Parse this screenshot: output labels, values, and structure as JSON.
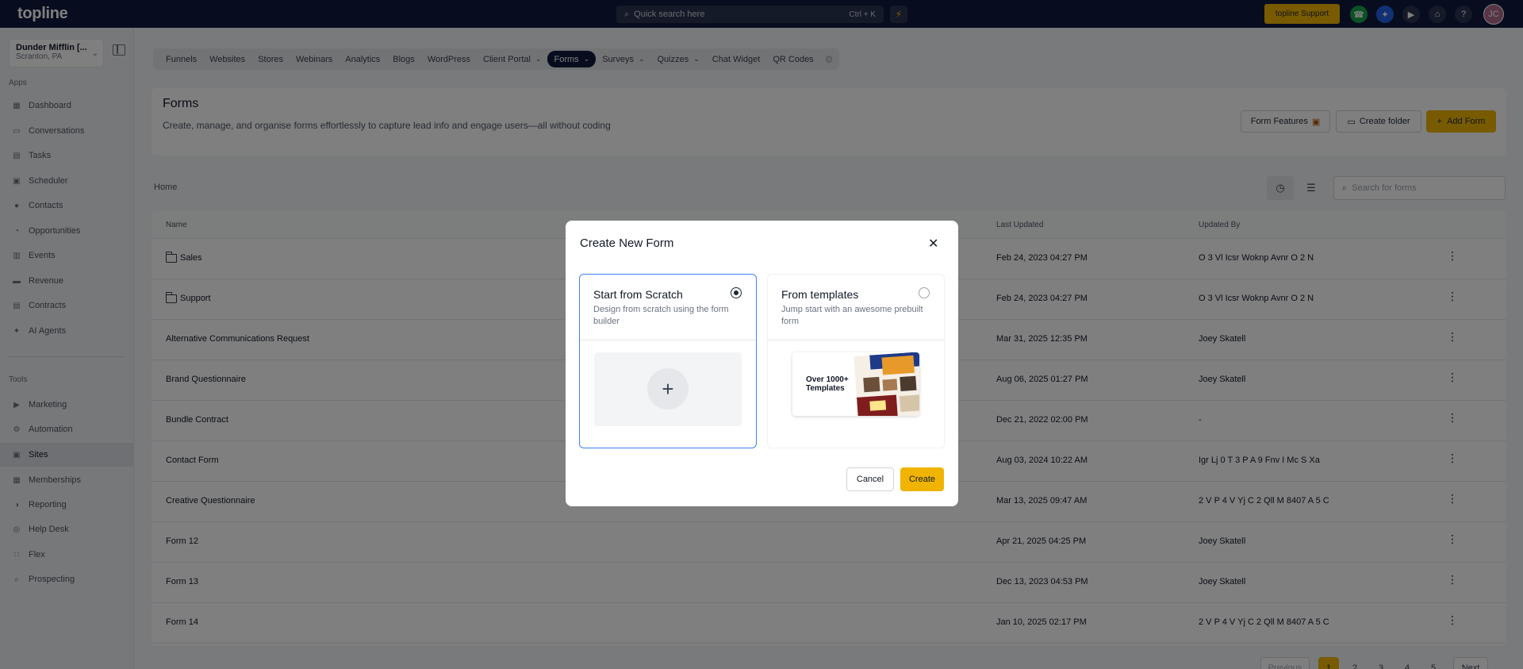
{
  "topbar": {
    "logo": "topline",
    "search_placeholder": "Quick search here",
    "search_shortcut": "Ctrl + K",
    "support_label": "topline Support",
    "avatar_initials": "JC"
  },
  "sidebar": {
    "account_name": "Dunder Mifflin [...",
    "account_location": "Scranton, PA",
    "apps_label": "Apps",
    "tools_label": "Tools",
    "apps": [
      {
        "label": "Dashboard",
        "icon": "dashboard-icon"
      },
      {
        "label": "Conversations",
        "icon": "chat-icon"
      },
      {
        "label": "Tasks",
        "icon": "tasks-icon"
      },
      {
        "label": "Scheduler",
        "icon": "calendar-icon"
      },
      {
        "label": "Contacts",
        "icon": "person-icon"
      },
      {
        "label": "Opportunities",
        "icon": "opportunities-icon"
      },
      {
        "label": "Events",
        "icon": "events-icon"
      },
      {
        "label": "Revenue",
        "icon": "revenue-icon"
      },
      {
        "label": "Contracts",
        "icon": "contracts-icon"
      },
      {
        "label": "AI Agents",
        "icon": "sparkle-icon"
      }
    ],
    "tools": [
      {
        "label": "Marketing",
        "icon": "megaphone-icon"
      },
      {
        "label": "Automation",
        "icon": "automation-icon"
      },
      {
        "label": "Sites",
        "icon": "sites-icon"
      },
      {
        "label": "Memberships",
        "icon": "memberships-icon"
      },
      {
        "label": "Reporting",
        "icon": "reporting-icon"
      },
      {
        "label": "Help Desk",
        "icon": "help-desk-icon"
      },
      {
        "label": "Flex",
        "icon": "flex-icon"
      },
      {
        "label": "Prospecting",
        "icon": "search-icon"
      }
    ]
  },
  "tabs": [
    "Funnels",
    "Websites",
    "Stores",
    "Webinars",
    "Analytics",
    "Blogs",
    "WordPress",
    "Client Portal",
    "Forms",
    "Surveys",
    "Quizzes",
    "Chat Widget",
    "QR Codes"
  ],
  "header": {
    "title": "Forms",
    "description": "Create, manage, and organise forms effortlessly to capture lead info and engage users—all without coding",
    "form_features_label": "Form Features",
    "create_folder_label": "Create folder",
    "add_form_label": "Add Form"
  },
  "breadcrumb": "Home",
  "forms_search_placeholder": "Search for forms",
  "table": {
    "columns": [
      "Name",
      "Last Updated",
      "Updated By"
    ],
    "rows": [
      {
        "name": "Sales",
        "folder": true,
        "updated": "Feb 24, 2023 04:27 PM",
        "by": "O 3 Vl Icsr Woknp Avnr O 2 N"
      },
      {
        "name": "Support",
        "folder": true,
        "updated": "Feb 24, 2023 04:27 PM",
        "by": "O 3 Vl Icsr Woknp Avnr O 2 N"
      },
      {
        "name": "Alternative Communications Request",
        "folder": false,
        "updated": "Mar 31, 2025 12:35 PM",
        "by": "Joey Skatell"
      },
      {
        "name": "Brand Questionnaire",
        "folder": false,
        "updated": "Aug 06, 2025 01:27 PM",
        "by": "Joey Skatell"
      },
      {
        "name": "Bundle Contract",
        "folder": false,
        "updated": "Dec 21, 2022 02:00 PM",
        "by": "-"
      },
      {
        "name": "Contact Form",
        "folder": false,
        "updated": "Aug 03, 2024 10:22 AM",
        "by": "Igr Lj 0 T 3 P A 9 Fnv I Mc S Xa"
      },
      {
        "name": "Creative Questionnaire",
        "folder": false,
        "updated": "Mar 13, 2025 09:47 AM",
        "by": "2 V P 4 V Yj C 2 Qll M 8407 A 5 C"
      },
      {
        "name": "Form 12",
        "folder": false,
        "updated": "Apr 21, 2025 04:25 PM",
        "by": "Joey Skatell"
      },
      {
        "name": "Form 13",
        "folder": false,
        "updated": "Dec 13, 2023 04:53 PM",
        "by": "Joey Skatell"
      },
      {
        "name": "Form 14",
        "folder": false,
        "updated": "Jan 10, 2025 02:17 PM",
        "by": "2 V P 4 V Yj C 2 Qll M 8407 A 5 C"
      }
    ]
  },
  "pagination": {
    "previous": "Previous",
    "pages": [
      "1",
      "2",
      "3",
      "4",
      "5"
    ],
    "current": "1",
    "next": "Next"
  },
  "modal": {
    "title": "Create New Form",
    "scratch_title": "Start from Scratch",
    "scratch_desc": "Design from scratch using the form builder",
    "templates_title": "From templates",
    "templates_desc": "Jump start with an awesome prebuilt form",
    "templates_card_text": "Over 1000+ Templates",
    "cancel_label": "Cancel",
    "create_label": "Create",
    "selected_option": "scratch"
  },
  "colors": {
    "topbar": "#0e1a3d",
    "accent": "#f0b400",
    "selected_border": "#3b82f6"
  }
}
